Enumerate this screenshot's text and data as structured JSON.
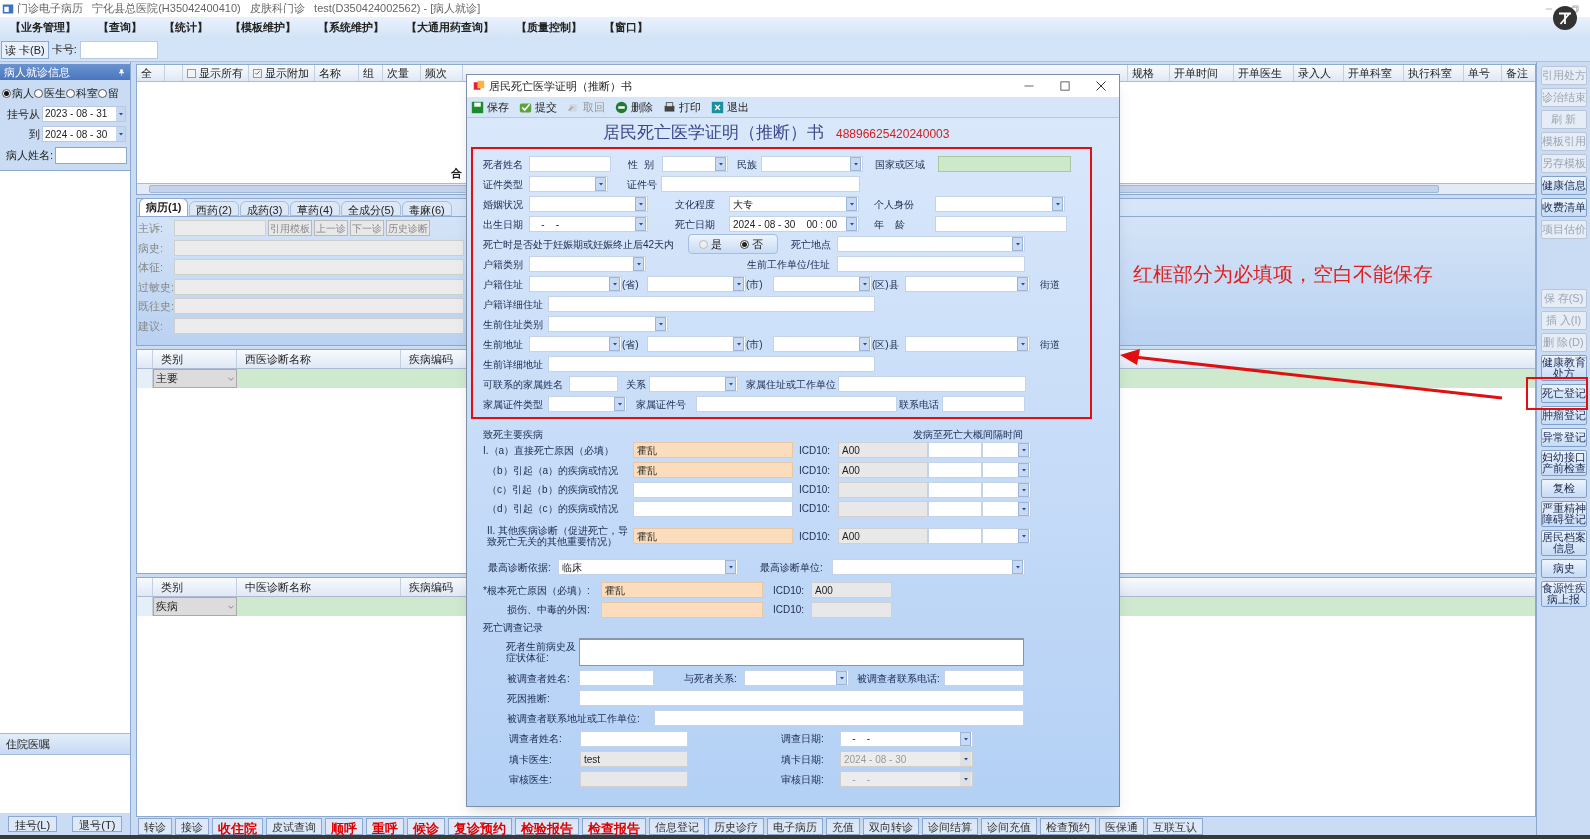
{
  "window": {
    "title": "门诊电子病历   宁化县总医院(H35042400410)   皮肤科门诊   test(D350424002562) - [病人就诊]"
  },
  "menu": [
    "【业务管理】",
    "【查询】",
    "【统计】",
    "【模板维护】",
    "【系统维护】",
    "【大通用药查询】",
    "【质量控制】",
    "【窗口】"
  ],
  "toolbar": {
    "read_card": "读 卡(B)",
    "card_label": "卡号:"
  },
  "patient_panel": {
    "title": "病人就诊信息",
    "filters": [
      {
        "label": "病人",
        "selected": true
      },
      {
        "label": "医生",
        "selected": false
      },
      {
        "label": "科室",
        "selected": false
      },
      {
        "label": "留",
        "selected": false
      }
    ],
    "from_label": "挂号从",
    "from": "2023 - 08 - 31",
    "to_label": "到",
    "to": "2024 - 08 - 30",
    "name_label": "病人姓名:",
    "orders_title": "住院医嘱",
    "buttons": [
      "挂号(L)",
      "退号(T)"
    ]
  },
  "order_table": {
    "left_columns": [
      {
        "kind": "text",
        "label": "全"
      },
      {
        "kind": "blank"
      },
      {
        "kind": "checkbox",
        "label": "显示所有",
        "checked": false
      },
      {
        "kind": "checkbox",
        "label": "显示附加",
        "checked": true
      },
      {
        "kind": "text",
        "label": "名称"
      },
      {
        "kind": "text",
        "label": "组"
      },
      {
        "kind": "text",
        "label": "次量"
      },
      {
        "kind": "text",
        "label": "频次"
      }
    ],
    "right_columns": [
      "规格",
      "开单时间",
      "开单医生",
      "录入人",
      "开单科室",
      "执行科室",
      "单号",
      "备注"
    ],
    "footer": "合"
  },
  "tabs": [
    {
      "label": "病历(1)",
      "selected": true
    },
    {
      "label": "西药(2)",
      "selected": false
    },
    {
      "label": "成药(3)",
      "selected": false
    },
    {
      "label": "草药(4)",
      "selected": false
    },
    {
      "label": "全成分(5)",
      "selected": false
    },
    {
      "label": "毒麻(6)",
      "selected": false
    }
  ],
  "record": {
    "fields": [
      "主诉:",
      "病史:",
      "体征:",
      "过敏史:",
      "既往史:",
      "建议:"
    ],
    "buttons": [
      "引用模板",
      "上一诊",
      "下一诊",
      "历史诊断"
    ]
  },
  "western_grid": {
    "columns": [
      "类别",
      "西医诊断名称",
      "疾病编码"
    ],
    "category": "主要"
  },
  "chinese_grid": {
    "columns": [
      "类别",
      "中医诊断名称",
      "疾病编码"
    ],
    "category": "疾病"
  },
  "side_buttons_top": [
    {
      "label": "引用处方",
      "disabled": true
    },
    {
      "label": "诊治结束",
      "disabled": true
    },
    {
      "label": "刷 新",
      "disabled": true
    },
    {
      "label": "模板引用",
      "disabled": true
    },
    {
      "label": "另存模板",
      "disabled": true
    },
    {
      "label": "健康信息",
      "disabled": false
    },
    {
      "label": "收费清单",
      "disabled": false
    },
    {
      "label": "项目估价",
      "disabled": true
    }
  ],
  "side_buttons_bottom": [
    {
      "label": "保 存(S)",
      "disabled": true
    },
    {
      "label": "插 入(I)",
      "disabled": true
    },
    {
      "label": "删 除(D)",
      "disabled": true
    },
    {
      "label": "健康教育处方",
      "disabled": false
    },
    {
      "label": "死亡登记",
      "disabled": false
    },
    {
      "label": "肿瘤登记",
      "disabled": false
    },
    {
      "label": "异常登记",
      "disabled": false
    },
    {
      "label": "妇幼接口产前检查",
      "disabled": false
    },
    {
      "label": "复检",
      "disabled": false
    },
    {
      "label": "严重精神障碍登记",
      "disabled": false
    },
    {
      "label": "居民档案信息",
      "disabled": false
    },
    {
      "label": "病史",
      "disabled": false
    },
    {
      "label": "食源性疾病上报",
      "disabled": false
    }
  ],
  "bottom_buttons": [
    {
      "label": "转诊",
      "kind": "normal"
    },
    {
      "label": "接诊",
      "kind": "normal"
    },
    {
      "label": "收住院",
      "kind": "alert"
    },
    {
      "label": "皮试查询",
      "kind": "normal"
    },
    {
      "label": "顺呼",
      "kind": "alert"
    },
    {
      "label": "重呼",
      "kind": "alert"
    },
    {
      "label": "候诊",
      "kind": "alert"
    },
    {
      "label": "复诊预约",
      "kind": "alert"
    },
    {
      "label": "检验报告",
      "kind": "alert"
    },
    {
      "label": "检查报告",
      "kind": "alert"
    },
    {
      "label": "信息登记",
      "kind": "normal"
    },
    {
      "label": "历史诊疗",
      "kind": "normal"
    },
    {
      "label": "电子病历",
      "kind": "normal"
    },
    {
      "label": "充值",
      "kind": "normal"
    },
    {
      "label": "双向转诊",
      "kind": "normal"
    },
    {
      "label": "诊间结算",
      "kind": "normal"
    },
    {
      "label": "诊间充值",
      "kind": "normal"
    },
    {
      "label": "检查预约",
      "kind": "normal"
    },
    {
      "label": "医保通",
      "kind": "normal"
    },
    {
      "label": "互联互认",
      "kind": "normal"
    }
  ],
  "annotation": {
    "text": "红框部分为必填项，空白不能保存"
  },
  "dialog": {
    "title": "居民死亡医学证明（推断）书",
    "toolbar": [
      {
        "label": "保存",
        "disabled": false
      },
      {
        "label": "提交",
        "disabled": false
      },
      {
        "label": "取回",
        "disabled": true
      },
      {
        "label": "删除",
        "disabled": false
      },
      {
        "label": "打印",
        "disabled": false
      },
      {
        "label": "退出",
        "disabled": false
      }
    ],
    "heading": "居民死亡医学证明（推断）书",
    "serial": "48896625420240003",
    "required_rows": [
      [
        {
          "kind": "label",
          "text": "死者姓名"
        },
        {
          "kind": "input"
        },
        {
          "kind": "label",
          "text": "性  别"
        },
        {
          "kind": "select"
        },
        {
          "kind": "label",
          "text": "民族"
        },
        {
          "kind": "select"
        },
        {
          "kind": "label",
          "text": "国家或区域"
        },
        {
          "kind": "lookup"
        }
      ],
      [
        {
          "kind": "label",
          "text": "证件类型"
        },
        {
          "kind": "select"
        },
        {
          "kind": "label",
          "text": "证件号"
        },
        {
          "kind": "input"
        }
      ],
      [
        {
          "kind": "label",
          "text": "婚姻状况"
        },
        {
          "kind": "select"
        },
        {
          "kind": "label",
          "text": "文化程度"
        },
        {
          "kind": "select",
          "value": "大专"
        },
        {
          "kind": "label",
          "text": "个人身份"
        },
        {
          "kind": "select"
        }
      ],
      [
        {
          "kind": "label",
          "text": "出生日期"
        },
        {
          "kind": "select",
          "value": "   -    -"
        },
        {
          "kind": "label",
          "text": "死亡日期"
        },
        {
          "kind": "select",
          "value": "2024 - 08 - 30    00 : 00"
        },
        {
          "kind": "label",
          "text": "年    龄"
        },
        {
          "kind": "input"
        }
      ],
      [
        {
          "kind": "label",
          "text": "死亡时是否处于妊娠期或妊娠终止后42天内"
        },
        {
          "kind": "radio",
          "options": [
            {
              "label": "是",
              "selected": false
            },
            {
              "label": "否",
              "selected": true
            }
          ]
        },
        {
          "kind": "label",
          "text": "死亡地点"
        },
        {
          "kind": "select"
        }
      ],
      [
        {
          "kind": "label",
          "text": "户籍类别"
        },
        {
          "kind": "select"
        },
        {
          "kind": "label",
          "text": "生前工作单位/住址"
        },
        {
          "kind": "input"
        }
      ],
      [
        {
          "kind": "label",
          "text": "户籍住址"
        },
        {
          "kind": "select"
        },
        {
          "kind": "label",
          "text": "(省)"
        },
        {
          "kind": "select"
        },
        {
          "kind": "label",
          "text": "(市)"
        },
        {
          "kind": "select"
        },
        {
          "kind": "label",
          "text": "(区)县"
        },
        {
          "kind": "select"
        },
        {
          "kind": "label",
          "text": "街道"
        }
      ],
      [
        {
          "kind": "label",
          "text": "户籍详细住址"
        },
        {
          "kind": "input"
        }
      ],
      [
        {
          "kind": "label",
          "text": "生前住址类别"
        },
        {
          "kind": "select"
        }
      ],
      [
        {
          "kind": "label",
          "text": "生前地址"
        },
        {
          "kind": "select"
        },
        {
          "kind": "label",
          "text": "(省)"
        },
        {
          "kind": "select"
        },
        {
          "kind": "label",
          "text": "(市)"
        },
        {
          "kind": "select"
        },
        {
          "kind": "label",
          "text": "(区)县"
        },
        {
          "kind": "select"
        },
        {
          "kind": "label",
          "text": "街道"
        }
      ],
      [
        {
          "kind": "label",
          "text": "生前详细地址"
        },
        {
          "kind": "input"
        }
      ],
      [
        {
          "kind": "label",
          "text": "可联系的家属姓名"
        },
        {
          "kind": "input"
        },
        {
          "kind": "label",
          "text": "关系"
        },
        {
          "kind": "select"
        },
        {
          "kind": "label",
          "text": "家属住址或工作单位"
        },
        {
          "kind": "input"
        }
      ],
      [
        {
          "kind": "label",
          "text": "家属证件类型"
        },
        {
          "kind": "select"
        },
        {
          "kind": "label",
          "text": "家属证件号"
        },
        {
          "kind": "input"
        },
        {
          "kind": "label",
          "text": "联系电话"
        },
        {
          "kind": "input"
        }
      ]
    ],
    "other_rows": [
      [
        {
          "kind": "label",
          "text": "致死主要疾病"
        },
        {
          "kind": "label",
          "text": "发病至死亡大概间隔时间"
        }
      ],
      [
        {
          "kind": "label",
          "text": "I.（a）直接死亡原因（必填）"
        },
        {
          "kind": "required_input",
          "value": "霍乱"
        },
        {
          "kind": "label",
          "text": "ICD10:"
        },
        {
          "kind": "readonly_input",
          "value": "A00"
        },
        {
          "kind": "input"
        },
        {
          "kind": "select"
        }
      ],
      [
        {
          "kind": "label",
          "text": "（b）引起（a）的疾病或情况"
        },
        {
          "kind": "required_input",
          "value": "霍乱"
        },
        {
          "kind": "label",
          "text": "ICD10:"
        },
        {
          "kind": "readonly_input",
          "value": "A00"
        },
        {
          "kind": "input"
        },
        {
          "kind": "select"
        }
      ],
      [
        {
          "kind": "label",
          "text": "（c）引起（b）的疾病或情况"
        },
        {
          "kind": "input"
        },
        {
          "kind": "label",
          "text": "ICD10:"
        },
        {
          "kind": "readonly_input"
        },
        {
          "kind": "input"
        },
        {
          "kind": "select"
        }
      ],
      [
        {
          "kind": "label",
          "text": "（d）引起（c）的疾病或情况"
        },
        {
          "kind": "input"
        },
        {
          "kind": "label",
          "text": "ICD10:"
        },
        {
          "kind": "readonly_input"
        },
        {
          "kind": "input"
        },
        {
          "kind": "select"
        }
      ],
      [
        {
          "kind": "label",
          "text": "II. 其他疾病诊断（促进死亡，导致死亡无关的其他重要情况）"
        },
        {
          "kind": "required_input",
          "value": "霍乱"
        },
        {
          "kind": "label",
          "text": "ICD10:"
        },
        {
          "kind": "readonly_input",
          "value": "A00"
        },
        {
          "kind": "input"
        },
        {
          "kind": "select"
        }
      ],
      [
        {
          "kind": "label",
          "text": "最高诊断依据:"
        },
        {
          "kind": "select",
          "value": "临床"
        },
        {
          "kind": "label",
          "text": "最高诊断单位:"
        },
        {
          "kind": "select"
        }
      ],
      [
        {
          "kind": "label",
          "text": "*根本死亡原因（必填）:"
        },
        {
          "kind": "required_input",
          "value": "霍乱"
        },
        {
          "kind": "label",
          "text": "ICD10:"
        },
        {
          "kind": "readonly_input",
          "value": "A00"
        }
      ],
      [
        {
          "kind": "label",
          "text": "损伤、中毒的外因:"
        },
        {
          "kind": "required_input"
        },
        {
          "kind": "label",
          "text": "ICD10:"
        },
        {
          "kind": "readonly_input"
        }
      ],
      [
        {
          "kind": "label",
          "text": "死亡调查记录"
        }
      ],
      [
        {
          "kind": "label",
          "text": "死者生前病史及症状体征:"
        },
        {
          "kind": "textarea"
        }
      ],
      [
        {
          "kind": "label",
          "text": "被调查者姓名:"
        },
        {
          "kind": "input"
        },
        {
          "kind": "label",
          "text": "与死者关系:"
        },
        {
          "kind": "select"
        },
        {
          "kind": "label",
          "text": "被调查者联系电话:"
        },
        {
          "kind": "input"
        }
      ],
      [
        {
          "kind": "label",
          "text": "死因推断:"
        },
        {
          "kind": "input"
        }
      ],
      [
        {
          "kind": "label",
          "text": "被调查者联系地址或工作单位:"
        },
        {
          "kind": "input"
        }
      ],
      [
        {
          "kind": "label",
          "text": "调查者姓名:"
        },
        {
          "kind": "input"
        },
        {
          "kind": "label",
          "text": "调查日期:"
        },
        {
          "kind": "select",
          "value": "   -    -"
        }
      ],
      [
        {
          "kind": "label",
          "text": "填卡医生:"
        },
        {
          "kind": "readonly_input",
          "value": "test"
        },
        {
          "kind": "label",
          "text": "填卡日期:"
        },
        {
          "kind": "readonly_select",
          "value": "2024 - 08 - 30"
        }
      ],
      [
        {
          "kind": "label",
          "text": "审核医生:"
        },
        {
          "kind": "readonly_input"
        },
        {
          "kind": "label",
          "text": "审核日期:"
        },
        {
          "kind": "readonly_select",
          "value": "   -    -"
        }
      ]
    ]
  }
}
